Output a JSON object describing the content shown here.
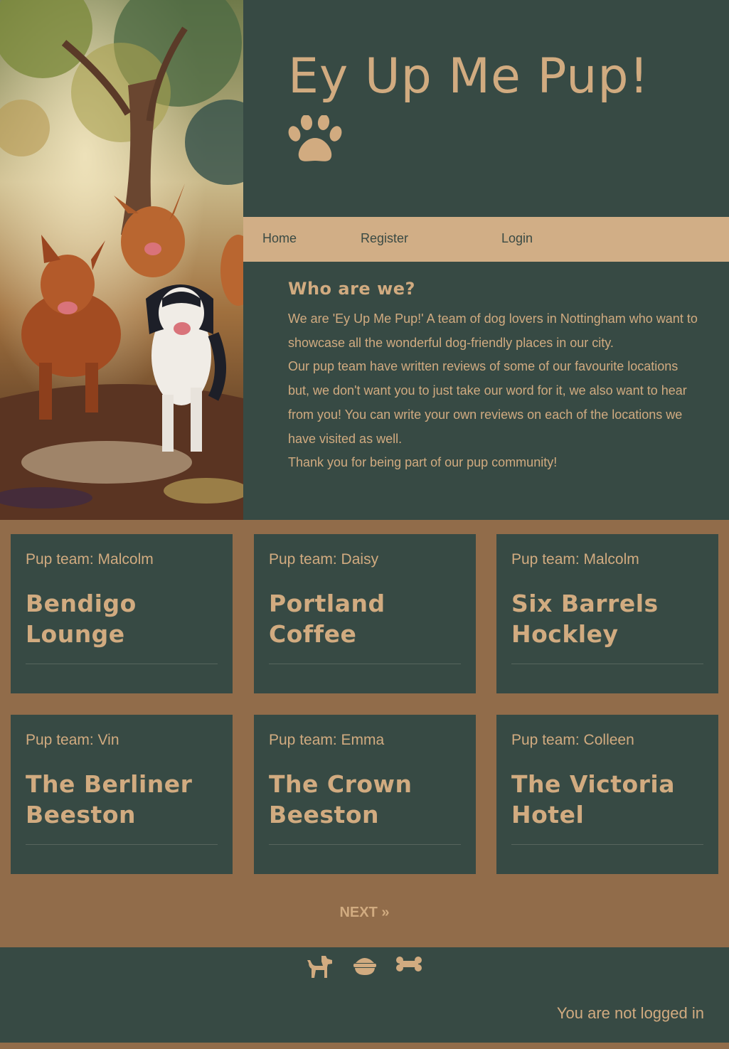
{
  "site": {
    "title": "Ey Up Me Pup!"
  },
  "nav": {
    "home": "Home",
    "register": "Register",
    "login": "Login"
  },
  "about": {
    "heading": "Who are we?",
    "body": "We are 'Ey Up Me Pup!' A team of dog lovers in Nottingham who want to showcase all the wonderful dog-friendly places in our city.\nOur pup team have written reviews of some of our favourite locations but, we don't want you to just take our word for it, we also want to hear from you! You can write your own reviews on each of the locations we have visited as well.\nThank you for being part of our pup community!"
  },
  "cards": [
    {
      "team": "Pup team: Malcolm",
      "title": "Bendigo Lounge"
    },
    {
      "team": "Pup team: Daisy",
      "title": "Portland Coffee"
    },
    {
      "team": "Pup team: Malcolm",
      "title": "Six Barrels Hockley"
    },
    {
      "team": "Pup team: Vin",
      "title": "The Berliner Beeston"
    },
    {
      "team": "Pup team: Emma",
      "title": "The Crown Beeston"
    },
    {
      "team": "Pup team: Colleen",
      "title": "The Victoria Hotel"
    }
  ],
  "pagination": {
    "next": "NEXT »"
  },
  "footer": {
    "icons": [
      "dog-icon",
      "food-bowl-icon",
      "bone-icon"
    ],
    "status": "You are not logged in"
  },
  "colors": {
    "dark_green": "#374a44",
    "tan": "#d1ab80",
    "brown": "#916c4a"
  }
}
